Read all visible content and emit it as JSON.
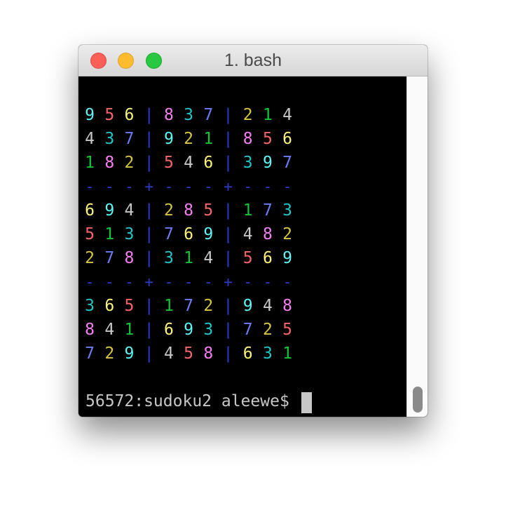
{
  "window": {
    "title": "1. bash"
  },
  "colors": {
    "1": "#11c53a",
    "2": "#d4c640",
    "3": "#22c5c8",
    "4": "#c7c7c7",
    "5": "#f3656a",
    "6": "#f9f37d",
    "7": "#6d7cf4",
    "8": "#f57ff0",
    "9": "#5ff4f5",
    "separator": "#2f3bcc"
  },
  "terminal": {
    "rows": [
      "956|837|214",
      "437|921|856",
      "182|546|397",
      "---+---+---",
      "694|285|173",
      "513|769|482",
      "278|314|569",
      "---+---+---",
      "365|172|948",
      "841|693|725",
      "729|458|631"
    ],
    "prompt": "56572:sudoku2 aleewe$"
  }
}
